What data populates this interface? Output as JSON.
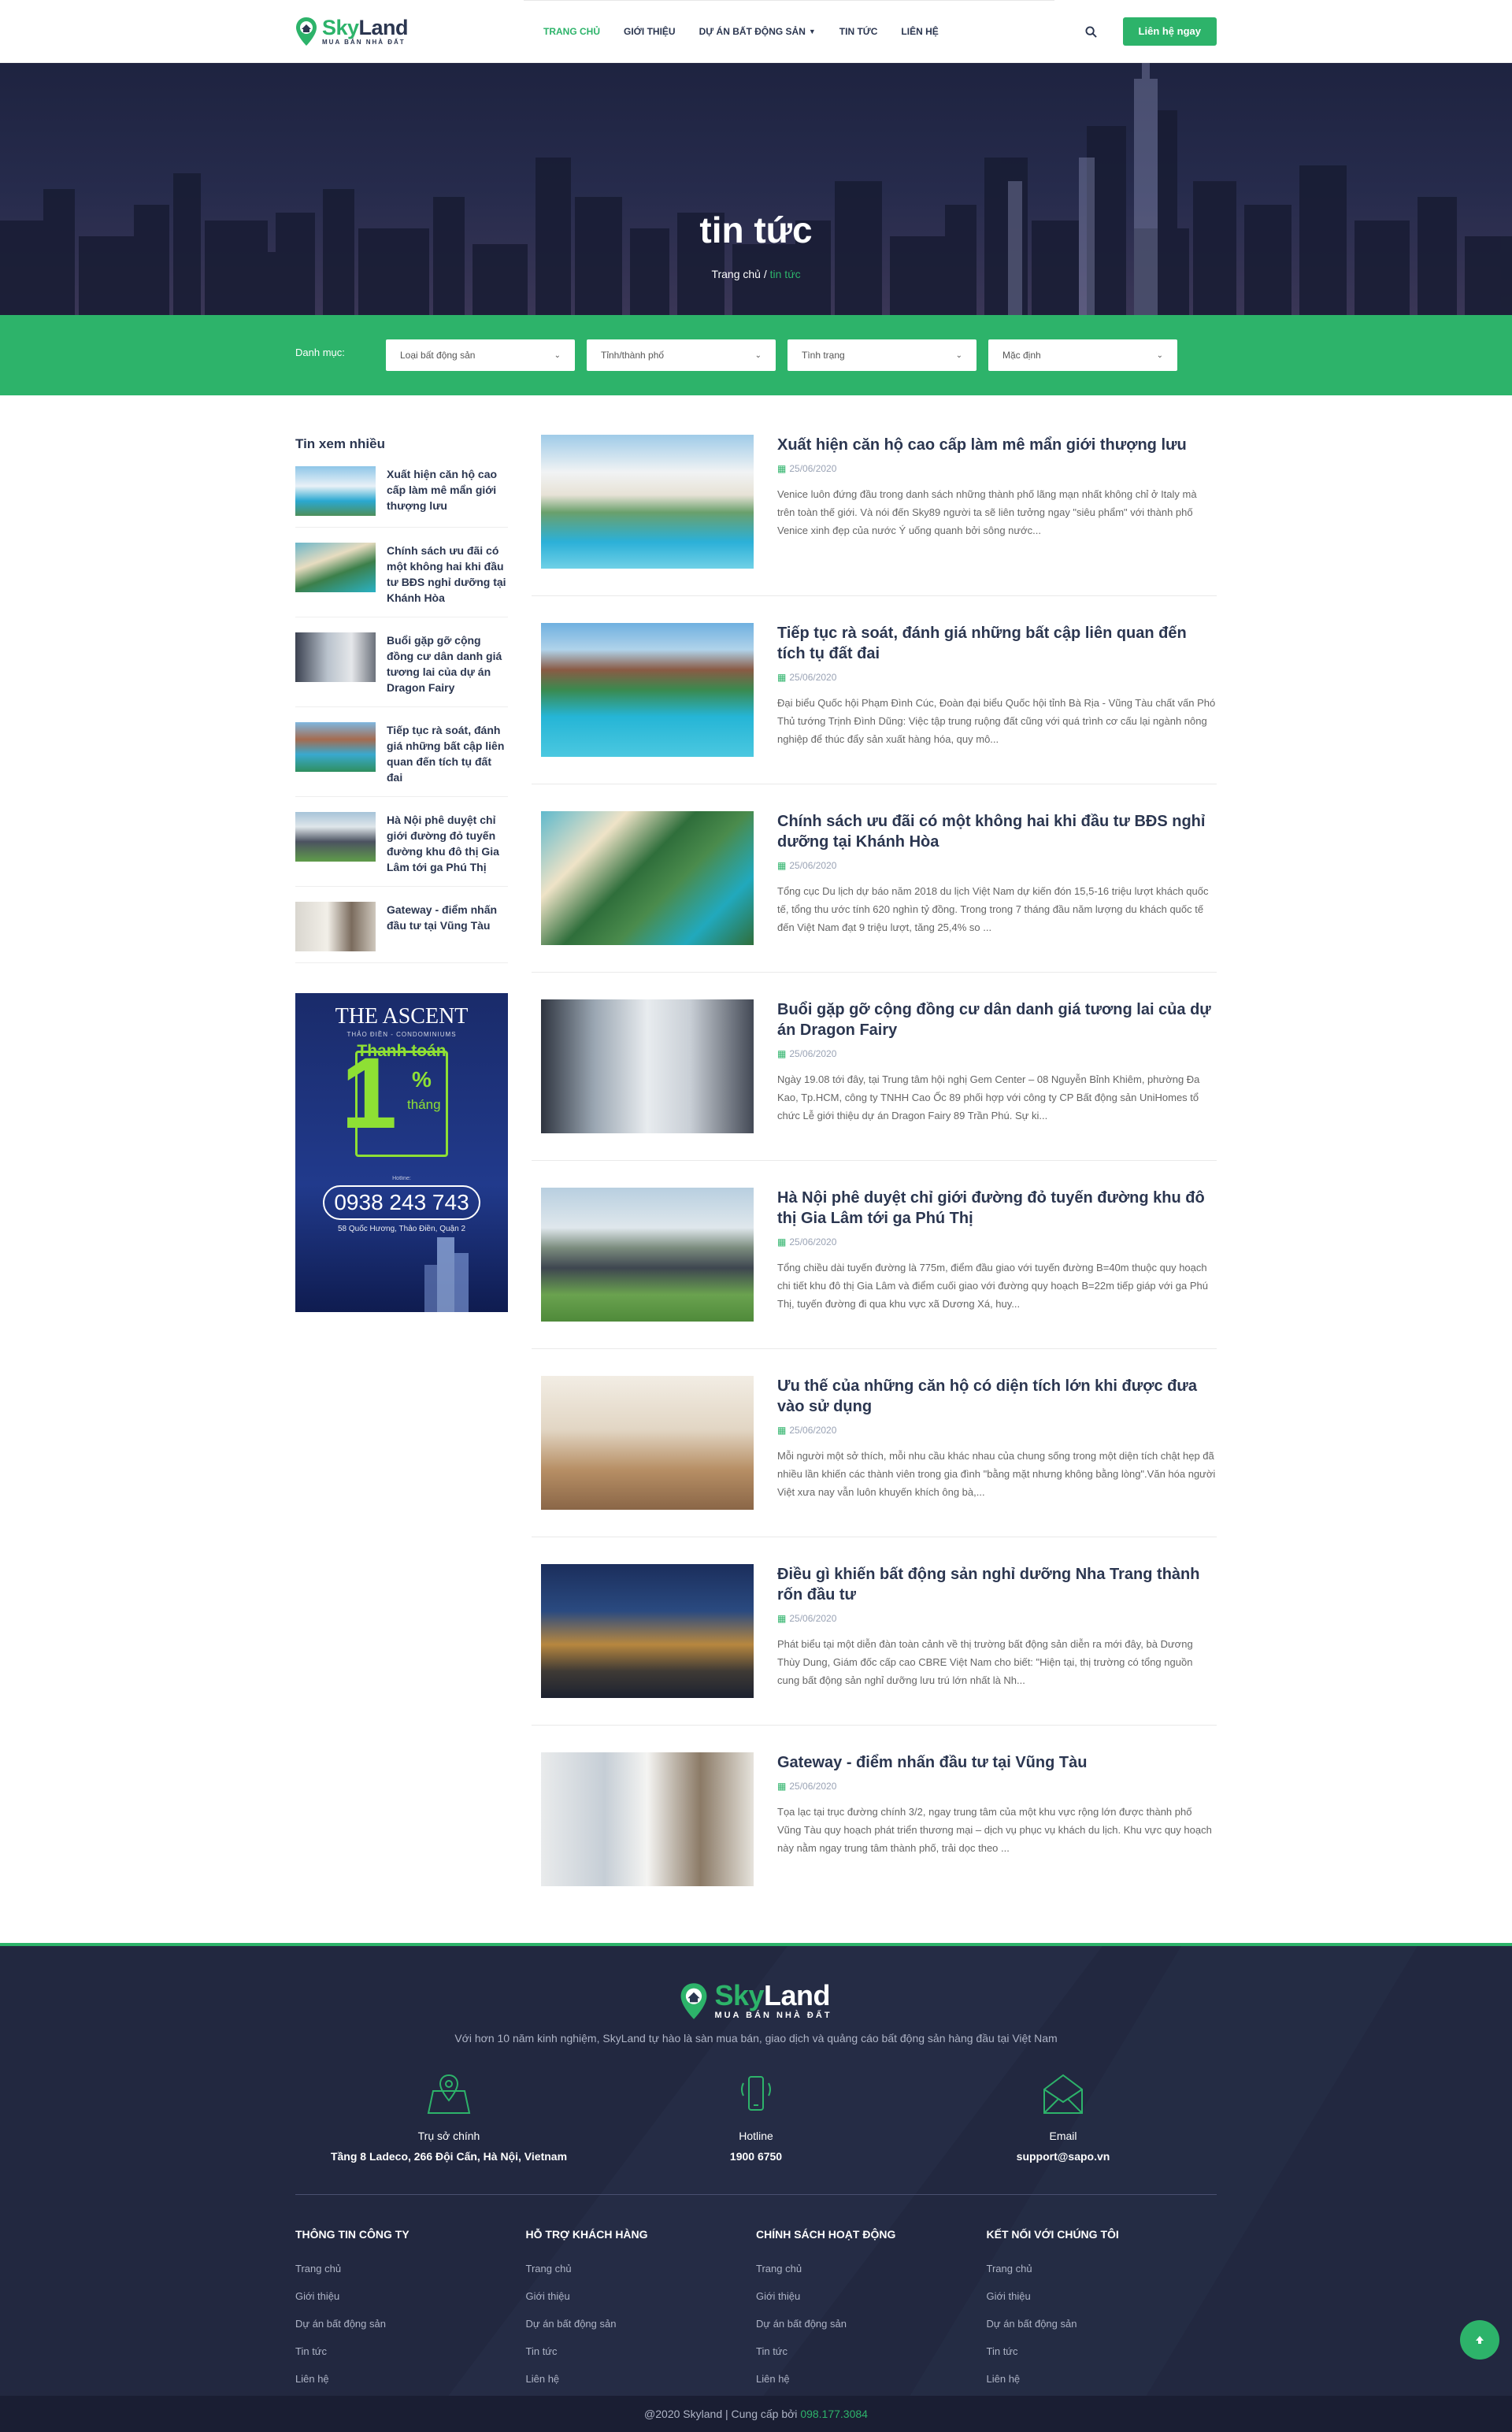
{
  "header": {
    "logo_name_a": "Sky",
    "logo_name_b": "Land",
    "logo_tag": "MUA BÁN NHÀ ĐẤT",
    "nav": [
      {
        "label": "TRANG CHỦ"
      },
      {
        "label": "GIỚI THIỆU"
      },
      {
        "label": "DỰ ÁN BẤT ĐỘNG SẢN"
      },
      {
        "label": "TIN TỨC"
      },
      {
        "label": "LIÊN HỆ"
      }
    ],
    "contact_button": "Liên hệ ngay"
  },
  "hero": {
    "title": "tin tức",
    "breadcrumb_home": "Trang chủ",
    "breadcrumb_sep": " / ",
    "breadcrumb_current": "tin tức"
  },
  "filter": {
    "label": "Danh mục:",
    "selects": [
      {
        "value": "Loại bất động sản"
      },
      {
        "value": "Tỉnh/thành phố"
      },
      {
        "value": "Tình trạng"
      },
      {
        "value": "Mặc định"
      }
    ]
  },
  "sidebar": {
    "title": "Tin xem nhiều",
    "items": [
      {
        "title": "Xuất hiện căn hộ cao cấp làm mê mẩn giới thượng lưu"
      },
      {
        "title": "Chính sách ưu đãi có một không hai khi đầu tư BĐS nghỉ dưỡng tại Khánh Hòa"
      },
      {
        "title": "Buổi gặp gỡ cộng đồng cư dân danh giá tương lai của dự án Dragon Fairy"
      },
      {
        "title": "Tiếp tục rà soát, đánh giá những bất cập liên quan đến tích tụ đất đai"
      },
      {
        "title": "Hà Nội phê duyệt chỉ giới đường đỏ tuyến đường khu đô thị Gia Lâm tới ga Phú Thị"
      },
      {
        "title": "Gateway - điểm nhấn đầu tư tại Vũng Tàu"
      }
    ],
    "ad": {
      "title": "THE ASCENT",
      "subtitle": "THẢO ĐIỀN - CONDOMINIUMS",
      "pay": "Thanh toán",
      "big": "1",
      "pct": "%",
      "month": "tháng",
      "hotline_label": "Hotline:",
      "phone": "0938 243 743",
      "address": "58 Quốc Hương, Thảo Điền, Quận 2"
    }
  },
  "posts": [
    {
      "title": "Xuất hiện căn hộ cao cấp làm mê mẩn giới thượng lưu",
      "date": "25/06/2020",
      "excerpt": "Venice luôn đứng đầu trong danh sách những thành phố lãng mạn nhất không chỉ ở Italy mà trên toàn thế giới. Và nói đến Sky89 người ta sẽ liên tưởng ngay \"siêu phẩm\" với thành phố Venice xinh đẹp của nước Ý uống quanh bởi sông nước..."
    },
    {
      "title": "Tiếp tục rà soát, đánh giá những bất cập liên quan đến tích tụ đất đai",
      "date": "25/06/2020",
      "excerpt": "Đại biểu Quốc hội Phạm Đình Cúc, Đoàn đại biểu Quốc hội tỉnh Bà Rịa - Vũng Tàu chất vấn Phó Thủ tướng Trịnh Đình Dũng: Việc tập trung ruộng đất cũng với quá trình cơ cấu lại ngành nông nghiệp để thúc đẩy sản xuất hàng hóa, quy mô..."
    },
    {
      "title": "Chính sách ưu đãi có một không hai khi đầu tư BĐS nghỉ dưỡng tại Khánh Hòa",
      "date": "25/06/2020",
      "excerpt": "Tổng cục Du lịch dự báo năm 2018 du lịch Việt Nam dự kiến đón 15,5-16 triệu lượt khách quốc tế, tổng thu ước tính 620 nghìn tỷ đồng. Trong trong 7 tháng đầu năm lượng du khách quốc tế đến Việt Nam đạt 9 triệu lượt, tăng 25,4% so ..."
    },
    {
      "title": "Buổi gặp gỡ cộng đồng cư dân danh giá tương lai của dự án Dragon Fairy",
      "date": "25/06/2020",
      "excerpt": "Ngày 19.08 tới đây, tại Trung tâm hội nghị Gem Center – 08 Nguyễn Bỉnh Khiêm, phường Đa Kao, Tp.HCM, công ty TNHH Cao Ốc 89 phối hợp với công ty CP Bất động sản UniHomes tổ chức Lễ giới thiệu dự án Dragon Fairy 89 Trần Phú. Sự ki..."
    },
    {
      "title": "Hà Nội phê duyệt chỉ giới đường đỏ tuyến đường khu đô thị Gia Lâm tới ga Phú Thị",
      "date": "25/06/2020",
      "excerpt": "Tổng chiều dài tuyến đường là 775m, điểm đầu giao với tuyến đường B=40m thuộc quy hoạch chi tiết khu đô thị Gia Lâm và điểm cuối giao với đường quy hoạch B=22m tiếp giáp với ga Phú Thị, tuyến đường đi qua khu vực xã Dương Xá, huy..."
    },
    {
      "title": "Ưu thế của những căn hộ có diện tích lớn khi được đưa vào sử dụng",
      "date": "25/06/2020",
      "excerpt": "Mỗi người một sở thích, mỗi nhu cầu khác nhau của chung sống trong một diện tích chật hẹp đã nhiều lần khiến các thành viên trong gia đình \"bằng mặt nhưng không bằng lòng\".Văn hóa người Việt xưa nay vẫn luôn khuyến khích ông bà,..."
    },
    {
      "title": "Điều gì khiến bất động sản nghỉ dưỡng Nha Trang thành rốn đầu tư",
      "date": "25/06/2020",
      "excerpt": "Phát biểu tại một diễn đàn toàn cảnh về thị trường bất động sản diễn ra mới đây, bà Dương Thùy Dung, Giám đốc cấp cao CBRE Việt Nam cho biết: \"Hiện tại, thị trường có tổng nguồn cung bất động sản nghỉ dưỡng lưu trú lớn nhất là Nh..."
    },
    {
      "title": "Gateway - điểm nhấn đầu tư tại Vũng Tàu",
      "date": "25/06/2020",
      "excerpt": "Tọa lạc tại trục đường chính 3/2, ngay trung tâm của một khu vực rộng lớn được thành phố Vũng Tàu quy hoạch phát triển thương mại – dịch vụ phục vụ khách du lịch. Khu vực quy hoạch này nằm ngay trung tâm thành phố, trải dọc theo ..."
    }
  ],
  "footer": {
    "intro": "Với hơn 10 năm kinh nghiệm, SkyLand tự hào là sàn mua bán, giao dịch và quảng cáo bất động sản hàng đầu tại Việt Nam",
    "contacts": [
      {
        "icon": "map-icon",
        "title": "Trụ sở chính",
        "value": "Tầng 8 Ladeco, 266 Đội Cấn, Hà Nội, Vietnam"
      },
      {
        "icon": "phone-icon",
        "title": "Hotline",
        "value": "1900 6750"
      },
      {
        "icon": "mail-icon",
        "title": "Email",
        "value": "support@sapo.vn"
      }
    ],
    "columns": [
      {
        "title": "THÔNG TIN CÔNG TY",
        "links": [
          "Trang chủ",
          "Giới thiệu",
          "Dự án bất động sản",
          "Tin tức",
          "Liên hệ"
        ]
      },
      {
        "title": "HỖ TRỢ KHÁCH HÀNG",
        "links": [
          "Trang chủ",
          "Giới thiệu",
          "Dự án bất động sản",
          "Tin tức",
          "Liên hệ"
        ]
      },
      {
        "title": "CHÍNH SÁCH HOẠT ĐỘNG",
        "links": [
          "Trang chủ",
          "Giới thiệu",
          "Dự án bất động sản",
          "Tin tức",
          "Liên hệ"
        ]
      },
      {
        "title": "KẾT NỐI VỚI CHÚNG TÔI",
        "links": [
          "Trang chủ",
          "Giới thiệu",
          "Dự án bất động sản",
          "Tin tức",
          "Liên hệ"
        ]
      }
    ],
    "copyright": "@2020 Skyland | Cung cấp bởi ",
    "copyright_phone": "098.177.3084"
  },
  "colors": {
    "accent": "#2db36a",
    "navy": "#2b3650",
    "footer_bg": "#222840"
  }
}
